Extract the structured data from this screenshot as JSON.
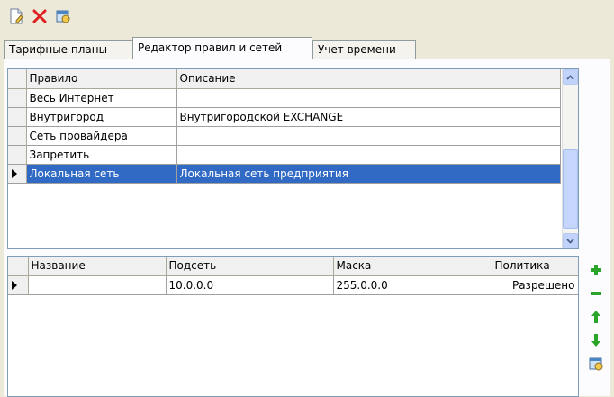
{
  "tabs": [
    {
      "label": "Тарифные планы"
    },
    {
      "label": "Редактор правил и сетей"
    },
    {
      "label": "Учет времени"
    }
  ],
  "active_tab": 1,
  "rules_grid": {
    "columns": [
      "Правило",
      "Описание"
    ],
    "rows": [
      {
        "rule": "Весь Интернет",
        "description": ""
      },
      {
        "rule": "Внутригород",
        "description": "Внутригородской EXCHANGE"
      },
      {
        "rule": "Сеть провайдера",
        "description": ""
      },
      {
        "rule": "Запретить",
        "description": ""
      },
      {
        "rule": "Локальная сеть",
        "description": "Локальная сеть предприятия"
      }
    ],
    "selected_row": 4
  },
  "networks_grid": {
    "columns": [
      "Название",
      "Подсеть",
      "Маска",
      "Политика"
    ],
    "rows": [
      {
        "name": "",
        "subnet": "10.0.0.0",
        "mask": "255.0.0.0",
        "policy": "Разрешено"
      }
    ]
  },
  "icons": {
    "toolbar": [
      "new-document-icon",
      "delete-icon",
      "edit-icon"
    ],
    "side": [
      "add-icon",
      "remove-icon",
      "move-up-icon",
      "move-down-icon",
      "edit-icon"
    ]
  },
  "colors": {
    "selection": "#316ac5",
    "add": "#2aa52a",
    "remove": "#2aa52a",
    "delete": "#e02020"
  }
}
